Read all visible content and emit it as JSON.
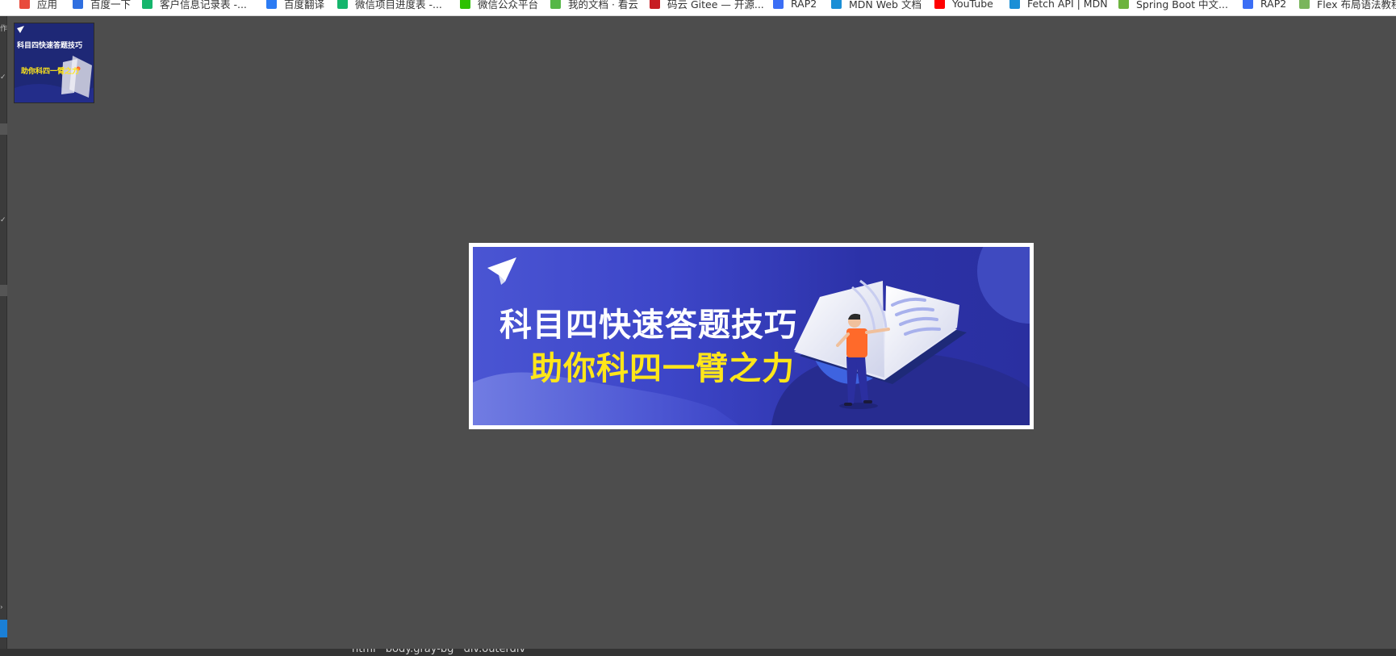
{
  "bookmarks": [
    {
      "label": "应用",
      "icon": "apps-grid-icon",
      "color": "#e84b3c"
    },
    {
      "label": "百度一下",
      "icon": "baidu-paw-icon",
      "color": "#2f6fe0"
    },
    {
      "label": "客户信息记录表 -...",
      "icon": "sheet-icon",
      "color": "#15b56c"
    },
    {
      "label": "百度翻译",
      "icon": "translate-icon",
      "color": "#2b7bf3"
    },
    {
      "label": "微信项目进度表 -...",
      "icon": "sheet-icon",
      "color": "#15b56c"
    },
    {
      "label": "微信公众平台",
      "icon": "wechat-icon",
      "color": "#2dc100"
    },
    {
      "label": "我的文档 · 看云",
      "icon": "kancloud-icon",
      "color": "#55b747"
    },
    {
      "label": "码云 Gitee — 开源...",
      "icon": "gitee-icon",
      "color": "#c71d23"
    },
    {
      "label": "RAP2",
      "icon": "rap2-icon",
      "color": "#3b6ef5"
    },
    {
      "label": "MDN Web 文档",
      "icon": "mdn-icon",
      "color": "#1b8fd6"
    },
    {
      "label": "YouTube",
      "icon": "youtube-icon",
      "color": "#ff0000"
    },
    {
      "label": "Fetch API | MDN",
      "icon": "mdn-icon",
      "color": "#1b8fd6"
    },
    {
      "label": "Spring Boot 中文...",
      "icon": "spring-icon",
      "color": "#6db33f"
    },
    {
      "label": "RAP2",
      "icon": "rap2-icon",
      "color": "#3b6ef5"
    },
    {
      "label": "Flex 布局语法教程",
      "icon": "ruanyifeng-icon",
      "color": "#7ab55c"
    }
  ],
  "banner": {
    "title_line1": "科目四快速答题技巧",
    "title_line2": "助你科四一臂之力",
    "title_color": "#ffffff",
    "subtitle_color": "#ffe619",
    "background_color": "#3d46c8"
  },
  "breadcrumb": [
    "html",
    "body.gray-bg",
    "div.outerdiv"
  ]
}
